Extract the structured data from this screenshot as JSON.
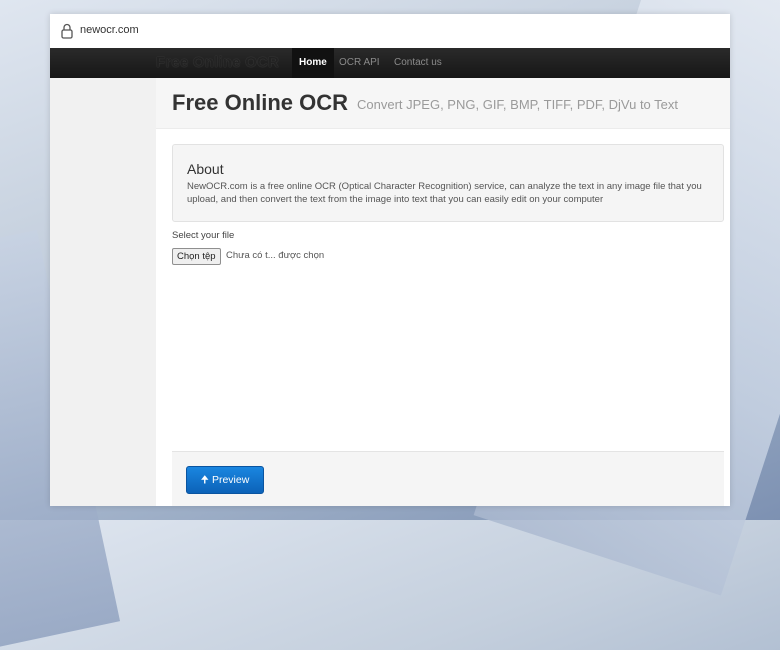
{
  "browser": {
    "url": "newocr.com"
  },
  "navbar": {
    "brand": "Free Online OCR",
    "items": [
      {
        "label": "Home",
        "active": true
      },
      {
        "label": "OCR API",
        "active": false
      },
      {
        "label": "Contact us",
        "active": false
      }
    ]
  },
  "hero": {
    "title": "Free Online OCR",
    "subtitle": "Convert JPEG, PNG, GIF, BMP, TIFF, PDF, DjVu to Text"
  },
  "about": {
    "title": "About",
    "text": "NewOCR.com is a free online OCR (Optical Character Recognition) service, can analyze the text in any image file that you upload, and then convert the text from the image into text that you can easily edit on your computer"
  },
  "upload": {
    "label": "Select your file",
    "button_label": "Chọn tệp",
    "status": "Chưa có t... được chọn"
  },
  "footer": {
    "preview_label": "Preview"
  },
  "colors": {
    "nav_bg": "#1c1c1c",
    "accent_blue": "#1575d0",
    "sidebar_bg": "#f1f1f1"
  }
}
